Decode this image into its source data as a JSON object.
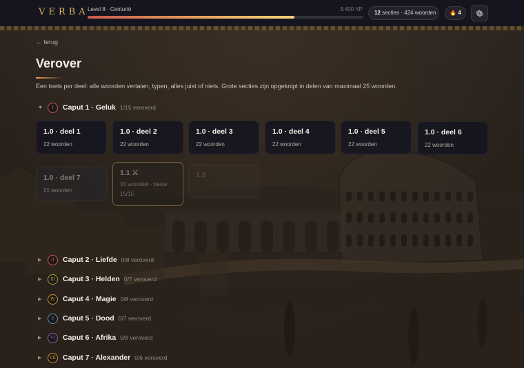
{
  "header": {
    "logo": "VERBA",
    "level_label": "Level 8 · Centuriō",
    "xp_label": "3.400 XP",
    "xp_progress": 0.75,
    "sections_count": "12",
    "sections_text": "secties · 424 woorden",
    "streak_count": "4",
    "flame_icon": "flame-icon",
    "settings_icon": "gear-icon"
  },
  "page": {
    "back_label": "← terug",
    "title": "Verover",
    "description": "Een toets per deel: alle woorden vertalen, typen, alles juist of niets. Grote secties zijn opgeknipt in delen van maximaal 25 woorden."
  },
  "chapters": [
    {
      "numeral": "I",
      "title": "Caput 1 · Geluk",
      "progress": "1/15 veroverd",
      "expanded": true,
      "color": "#c8574a"
    },
    {
      "numeral": "II",
      "title": "Caput 2 · Liefde",
      "progress": "0/8 veroverd",
      "expanded": false,
      "color": "#c8574a"
    },
    {
      "numeral": "III",
      "title": "Caput 3 · Helden",
      "progress": "0/7 veroverd",
      "expanded": false,
      "color": "#9aa63a"
    },
    {
      "numeral": "IV",
      "title": "Caput 4 · Magie",
      "progress": "0/8 veroverd",
      "expanded": false,
      "color": "#c9932f"
    },
    {
      "numeral": "V",
      "title": "Caput 5 · Dood",
      "progress": "0/7 veroverd",
      "expanded": false,
      "color": "#5f8ea8"
    },
    {
      "numeral": "VI",
      "title": "Caput 6 · Afrika",
      "progress": "0/8 veroverd",
      "expanded": false,
      "color": "#8a5fa8"
    },
    {
      "numeral": "VII",
      "title": "Caput 7 · Alexander",
      "progress": "0/6 veroverd",
      "expanded": false,
      "color": "#c9932f"
    }
  ],
  "sections": [
    {
      "title": "1.0 · deel 1",
      "sub": "22 woorden"
    },
    {
      "title": "1.0 · deel 2",
      "sub": "22 woorden"
    },
    {
      "title": "1.0 · deel 3",
      "sub": "22 woorden"
    },
    {
      "title": "1.0 · deel 4",
      "sub": "22 woorden"
    },
    {
      "title": "1.0 · deel 5",
      "sub": "22 woorden"
    },
    {
      "title": "1.0 · deel 6",
      "sub": "22 woorden"
    },
    {
      "title": "1.0 · deel 7",
      "sub": "21 woorden"
    },
    {
      "title": "1.1 ⚔",
      "sub": "15 woorden · beste",
      "sub2": "15/15"
    },
    {
      "title": "1.2"
    }
  ]
}
